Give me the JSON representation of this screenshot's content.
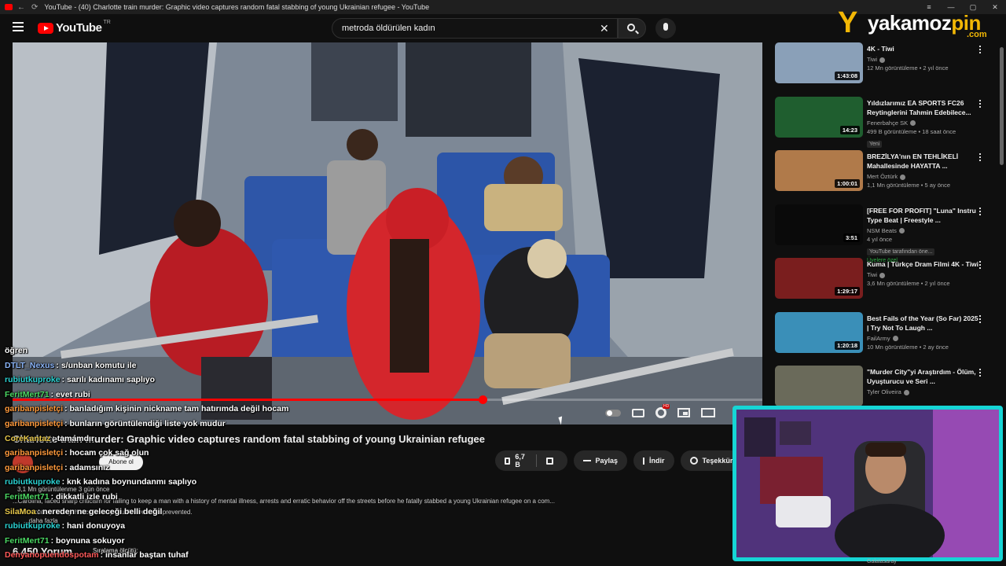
{
  "window": {
    "title": "YouTube - (40) Charlotte train murder: Graphic video captures random fatal stabbing of young Ukrainian refugee - YouTube"
  },
  "header": {
    "logo_text": "YouTube",
    "region": "TR",
    "search_value": "metroda öldürülen kadın"
  },
  "brand": {
    "name_a": "yakamoz",
    "name_b": "pin",
    "tld": ".com"
  },
  "player": {
    "progress_fraction": 0.627
  },
  "video": {
    "title": "Charlotte train murder: Graphic video captures random fatal stabbing of young Ukrainian refugee",
    "subscribe": "Abone ol",
    "likes": "6,7 B",
    "share": "Paylaş",
    "download": "İndir",
    "thanks": "Teşekkürler",
    "meta": "3,1 Mn görüntülenme  3 gün önce",
    "description": "...Carolina, faced sharp criticism for failing to keep a man with a history of mental illness, arrests and erratic behavior off the streets before he fatally stabbed a young Ukrainian refugee on a com...",
    "description2": "...last month, a killing that critics say could have been prevented.",
    "more": "...daha fazla",
    "comments_count": "6.450 Yorum",
    "sort_label": "Sıralama ölçütü:"
  },
  "chat": [
    {
      "user": "öğren",
      "text": "",
      "color": "#ffffff"
    },
    {
      "user": "DTLT_Nexus",
      "text": ": s/unban komutu ile",
      "color": "#8ab4f8"
    },
    {
      "user": "rubiutkuproke",
      "text": ": sarılı kadınamı saplıyo",
      "color": "#2bd4d4"
    },
    {
      "user": "FeritMert71",
      "text": ": evet rubi",
      "color": "#4cd964"
    },
    {
      "user": "garibanpisletçi",
      "text": ": banladığım kişinin nickname tam hatırımda değil hocam",
      "color": "#ff9a3c"
    },
    {
      "user": "garibanpisletçi",
      "text": ": bunların görüntülendiği liste yok mudur",
      "color": "#ff9a3c"
    },
    {
      "user": "CoreKantaz",
      "text": ": tamamdır",
      "color": "#e6c74a"
    },
    {
      "user": "garibanpisletçi",
      "text": ": hocam çok sağ olun",
      "color": "#ff9a3c"
    },
    {
      "user": "garibanpisletçi",
      "text": ": adamsınız",
      "color": "#ff9a3c"
    },
    {
      "user": "rubiutkuproke",
      "text": ": knk kadına boynundanmı saplıyo",
      "color": "#2bd4d4"
    },
    {
      "user": "FeritMert71",
      "text": ": dikkatli izle rubi",
      "color": "#4cd964"
    },
    {
      "user": "SilaMoa",
      "text": ": nereden ne geleceği belli değil",
      "color": "#e6c74a"
    },
    {
      "user": "rubiutkuproke",
      "text": ": hani donuyoya",
      "color": "#2bd4d4"
    },
    {
      "user": "FeritMert71",
      "text": ": boynuna sokuyor",
      "color": "#4cd964"
    },
    {
      "user": "Denyanopuendospotam",
      "text": ": insanlar baştan tuhaf",
      "color": "#ff5a5a"
    }
  ],
  "recommendations": [
    {
      "title": "4K - Tiwi",
      "channel": "Tiwi",
      "stats": "12 Mn görüntüleme • 2 yıl önce",
      "duration": "1:43:08",
      "badge": "",
      "member": "",
      "bg": "#8aa0b8"
    },
    {
      "title": "Yıldızlarımız EA SPORTS FC26 Reytinglerini Tahmin Edebilece...",
      "channel": "Fenerbahçe SK",
      "stats": "499 B görüntüleme • 18 saat önce",
      "duration": "14:23",
      "badge": "Yeni",
      "member": "",
      "bg": "#1f5e2f"
    },
    {
      "title": "BREZİLYA'nın EN TEHLİKELİ Mahallesinde HAYATTA ...",
      "channel": "Mert Öztürk",
      "stats": "1,1 Mn görüntüleme • 5 ay önce",
      "duration": "1:00:01",
      "badge": "",
      "member": "",
      "bg": "#b07a4a"
    },
    {
      "title": "[FREE FOR PROFIT] \"Luna\" Instru Type Beat | Freestyle ...",
      "channel": "NSM Beats",
      "stats": "4 yıl önce",
      "duration": "3:51",
      "badge": "YouTube tarafından öne...",
      "member": "Üyelere özel",
      "bg": "#0a0a0a"
    },
    {
      "title": "Kuma | Türkçe Dram Filmi 4K - Tiwi",
      "channel": "Tiwi",
      "stats": "3,6 Mn görüntüleme • 2 yıl önce",
      "duration": "1:29:17",
      "badge": "",
      "member": "",
      "bg": "#7a1e1e"
    },
    {
      "title": "Best Fails of the Year (So Far) 2025 | Try Not To Laugh ...",
      "channel": "FailArmy",
      "stats": "10 Mn görüntüleme • 2 ay önce",
      "duration": "1:20:18",
      "badge": "",
      "member": "",
      "bg": "#3a8fb8"
    },
    {
      "title": "\"Murder City\"yi Araştırdım - Ölüm, Uyuşturucu ve Seri ...",
      "channel": "Tyler Oliveira",
      "stats": "",
      "duration": "",
      "badge": "",
      "member": "",
      "bg": "#6a6a5a"
    }
  ],
  "cam": {
    "label": "Galatasaray"
  }
}
